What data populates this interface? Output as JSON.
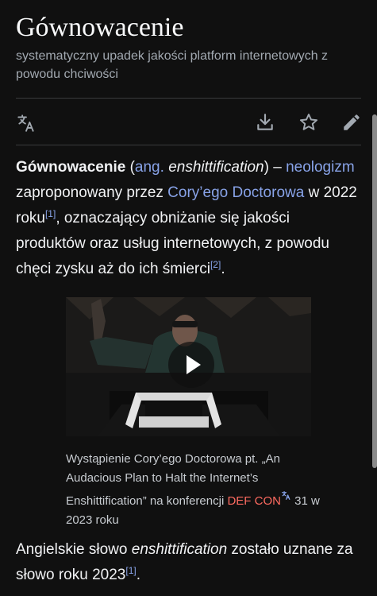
{
  "article": {
    "title": "Gównowacenie",
    "subtitle": "systematyczny upadek jakości platform internetowych z powodu chciwości"
  },
  "toolbar": {
    "language_icon": "translate-icon",
    "download_icon": "download-icon",
    "watch_icon": "star-icon",
    "edit_icon": "pencil-icon"
  },
  "lead": {
    "term": "Gówno­wacenie",
    "open_paren": " (",
    "lang_link": "ang.",
    "english_term": "enshittification",
    "close": ") –",
    "neologism_link": "neologizm",
    "text1": " zaproponowany przez ",
    "author_link": "Cory’ego Doctorowa",
    "text2": " w 2022 roku",
    "ref1": "[1]",
    "text3": ", oznaczający obniżanie się jakości produktów oraz usług internetowych, z powodu chęci zysku aż do ich śmierci",
    "ref2": "[2]",
    "period": "."
  },
  "media": {
    "play_icon": "play-icon",
    "caption_text": "Wystąpienie Cory’ego Doctorowa pt. „An Audacious Plan to Halt the Internet’s Enshittification” na konferencji ",
    "caption_link": "DEF CON",
    "caption_end": " 31 w 2023 roku",
    "translate_mark_icon": "translate-icon"
  },
  "para2": {
    "text1": "Angielskie słowo ",
    "term": "enshittification",
    "text2": " zostało uznane za słowo roku 2023",
    "ref": "[1]",
    "period": "."
  },
  "colors": {
    "background": "#101010",
    "link": "#88a3e8",
    "redlink": "#ff6b61",
    "text": "#eaecf0"
  }
}
